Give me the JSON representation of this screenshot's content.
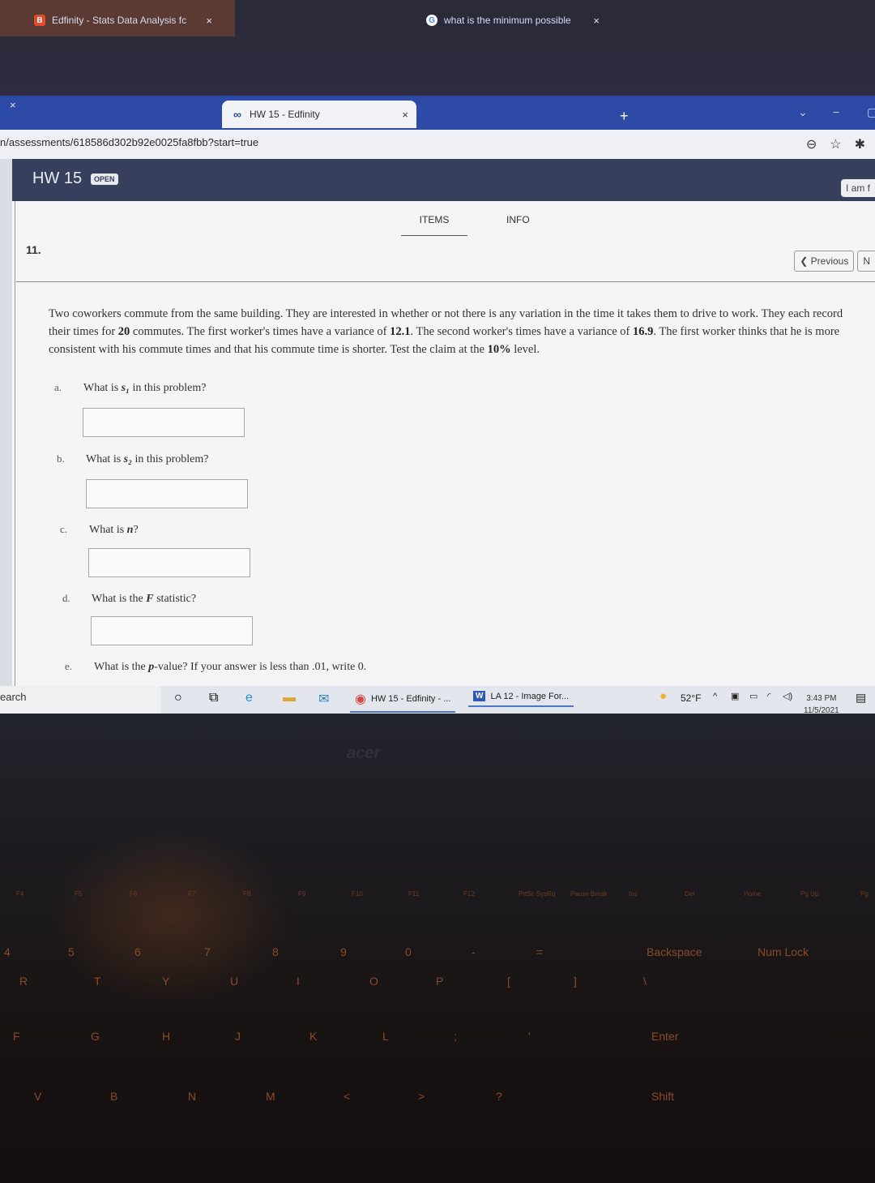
{
  "browser": {
    "tabs": [
      {
        "title": "Edfinity - Stats Data Analysis fc",
        "icon": "edfinity-b-icon",
        "active": false
      },
      {
        "title": "HW 15 - Edfinity",
        "icon": "edfinity-infinity-icon",
        "active": true
      },
      {
        "title": "what is the minimum possible",
        "icon": "google-icon",
        "active": false
      }
    ],
    "close_glyph": "×",
    "new_tab_glyph": "+",
    "url": "n/assessments/618586d302b92e0025fa8fbb?start=true",
    "minimize_glyph": "−"
  },
  "header": {
    "title": "HW 15",
    "status_badge": "OPEN",
    "right_button": "I am f"
  },
  "nav": {
    "tabs": [
      "ITEMS",
      "INFO"
    ],
    "active_tab": "ITEMS",
    "question_number": "11.",
    "previous_label": "Previous",
    "next_label": "N"
  },
  "problem": {
    "text_parts": [
      "Two coworkers commute from the same building. They are interested in whether or not there is any variation in the time it takes them to drive to work. They each record their times for ",
      "20",
      " commutes. The first worker's times have a variance of ",
      "12.1",
      ". The second worker's times have a variance of ",
      "16.9",
      ". The first worker thinks that he is more consistent with his commute times and that his commute time is shorter. Test the claim at the ",
      "10%",
      " level."
    ],
    "parts": [
      {
        "letter": "a.",
        "pre": "What is ",
        "var": "s₁",
        "post": " in this problem?",
        "answer": ""
      },
      {
        "letter": "b.",
        "pre": "What is ",
        "var": "s₂",
        "post": " in this problem?",
        "answer": ""
      },
      {
        "letter": "c.",
        "pre": "What is ",
        "var": "n",
        "post": "?",
        "answer": ""
      },
      {
        "letter": "d.",
        "pre": "What is the ",
        "var": "F",
        "post": " statistic?",
        "answer": ""
      },
      {
        "letter": "e.",
        "pre": "What is the ",
        "var": "p",
        "post": "-value? If your answer is less than .01, write 0.",
        "answer": null
      }
    ]
  },
  "taskbar": {
    "search_label": "earch",
    "apps": [
      {
        "label": "HW 15 - Edfinity - ...",
        "icon": "chrome-icon"
      },
      {
        "label": "LA 12 - Image For...",
        "icon": "word-icon"
      }
    ],
    "weather": "52°F",
    "time": "3:43 PM",
    "date": "11/5/2021"
  },
  "keyboard": {
    "brand": "acer",
    "fn_row": [
      "F4",
      "F5",
      "F6",
      "F7",
      "F8",
      "F9",
      "F10",
      "F11",
      "F12",
      "PrtSc SysRq",
      "Pause Break",
      "Ins",
      "Del",
      "Home",
      "Pg Up",
      "Pg"
    ],
    "number_row": [
      "4",
      "5",
      "6",
      "7",
      "8",
      "9",
      "0",
      "-",
      "=",
      "Backspace",
      "Num Lock"
    ],
    "top_letters": [
      "R",
      "T",
      "Y",
      "U",
      "I",
      "O",
      "P",
      "[",
      "]",
      "\\"
    ],
    "home_letters": [
      "F",
      "G",
      "H",
      "J",
      "K",
      "L",
      ";",
      "'",
      "Enter"
    ],
    "bottom_letters": [
      "V",
      "B",
      "N",
      "M",
      "<",
      ">",
      "?",
      "Shift"
    ]
  }
}
